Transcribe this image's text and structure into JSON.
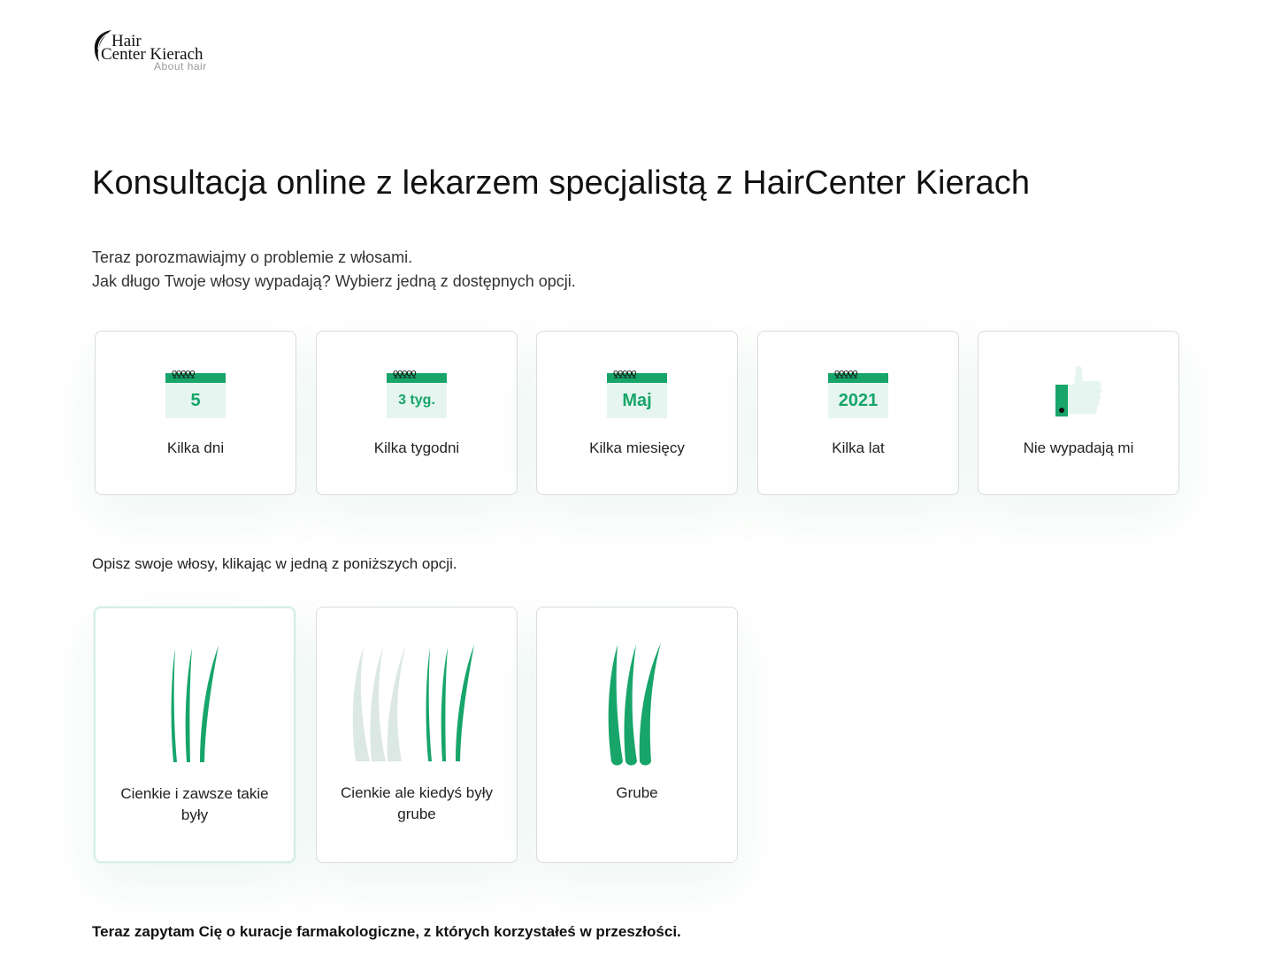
{
  "brand": {
    "line1": "Hair",
    "line2": "Center Kierach",
    "tagline": "About hair"
  },
  "page": {
    "title": "Konsultacja online z lekarzem specjalistą z HairCenter Kierach",
    "intro_line1": "Teraz porozmawiajmy o problemie z włosami.",
    "intro_line2": "Jak długo Twoje włosy wypadają? Wybierz jedną z dostępnych opcji."
  },
  "duration_options": [
    {
      "icon": "calendar-icon",
      "calendar_value": "5",
      "label": "Kilka dni"
    },
    {
      "icon": "calendar-icon",
      "calendar_value": "3 tyg.",
      "label": "Kilka tygodni"
    },
    {
      "icon": "calendar-icon",
      "calendar_value": "Maj",
      "label": "Kilka miesięcy"
    },
    {
      "icon": "calendar-icon",
      "calendar_value": "2021",
      "label": "Kilka lat"
    },
    {
      "icon": "thumbs-up-icon",
      "label": "Nie wypadają mi"
    }
  ],
  "hair_question": "Opisz swoje włosy, klikając w jedną z poniższych opcji.",
  "hair_options": [
    {
      "icon": "thin-hair-icon",
      "label": "Cienkie i zawsze takie były",
      "selected": true
    },
    {
      "icon": "thinning-hair-icon",
      "label": "Cienkie ale kiedyś były grube",
      "selected": false
    },
    {
      "icon": "thick-hair-icon",
      "label": "Grube",
      "selected": false
    }
  ],
  "next_question": "Teraz zapytam Cię o kuracje farmakologiczne, z których korzystałeś w przeszłości.",
  "colors": {
    "accent": "#17a56a",
    "accent_light": "#e6f5ef",
    "faded_hair": "#dbe8e3"
  }
}
